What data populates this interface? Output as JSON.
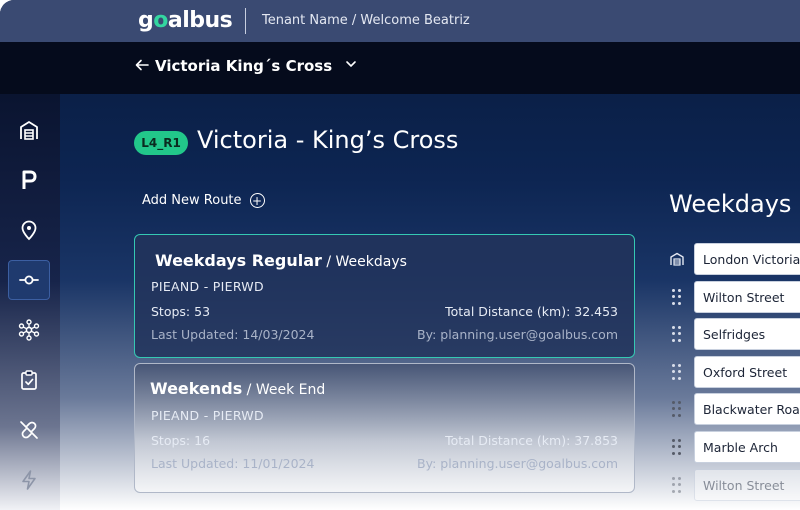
{
  "header": {
    "logo_prefix": "g",
    "logo_o": "o",
    "logo_suffix": "albus",
    "tenant_text": "Tenant Name / Welcome Beatriz"
  },
  "subheader": {
    "back_icon": "arrow-left-icon",
    "route_name": "Victoria King´s Cross",
    "dropdown_icon": "chevron-down-icon"
  },
  "sidebar": {
    "items": [
      {
        "name": "depot-icon",
        "active": false
      },
      {
        "name": "parking-icon",
        "label": "P",
        "active": false
      },
      {
        "name": "location-pin-icon",
        "active": false
      },
      {
        "name": "route-icon",
        "active": true
      },
      {
        "name": "network-icon",
        "active": false
      },
      {
        "name": "clipboard-check-icon",
        "active": false
      },
      {
        "name": "unlink-icon",
        "active": false
      },
      {
        "name": "lightning-icon",
        "active": false
      }
    ]
  },
  "page": {
    "badge": "L4_R1",
    "title": "Victoria - King’s Cross",
    "add_route_label": "Add New Route"
  },
  "routes": [
    {
      "name": "Weekdays Regular",
      "separator": " / ",
      "schedule": "Weekdays",
      "code": "PIEAND - PIERWD",
      "stops": "Stops: 53",
      "distance": "Total Distance (km): 32.453",
      "updated": "Last Updated: 14/03/2024",
      "by": "By: planning.user@goalbus.com",
      "selected": true
    },
    {
      "name": "Weekends",
      "separator": " / ",
      "schedule": "Week End",
      "code": "PIEAND - PIERWD",
      "stops": "Stops: 16",
      "distance": "Total Distance (km): 37.853",
      "updated": "Last Updated: 11/01/2024",
      "by": "By: planning.user@goalbus.com",
      "selected": false
    }
  ],
  "stops_panel": {
    "title": "Weekdays",
    "stops": [
      {
        "name": "London Victoria",
        "handle": "depot-icon"
      },
      {
        "name": "Wilton Street",
        "handle": "drag-handle-icon"
      },
      {
        "name": "Selfridges",
        "handle": "drag-handle-icon"
      },
      {
        "name": "Oxford Street",
        "handle": "drag-handle-icon"
      },
      {
        "name": "Blackwater Road",
        "handle": "drag-handle-icon"
      },
      {
        "name": "Marble Arch",
        "handle": "drag-handle-icon"
      },
      {
        "name": "Wilton Street",
        "handle": "drag-handle-icon"
      }
    ]
  },
  "colors": {
    "accent": "#22c78a",
    "selected_border": "#35c9b3",
    "topbar": "#3a4a72"
  }
}
